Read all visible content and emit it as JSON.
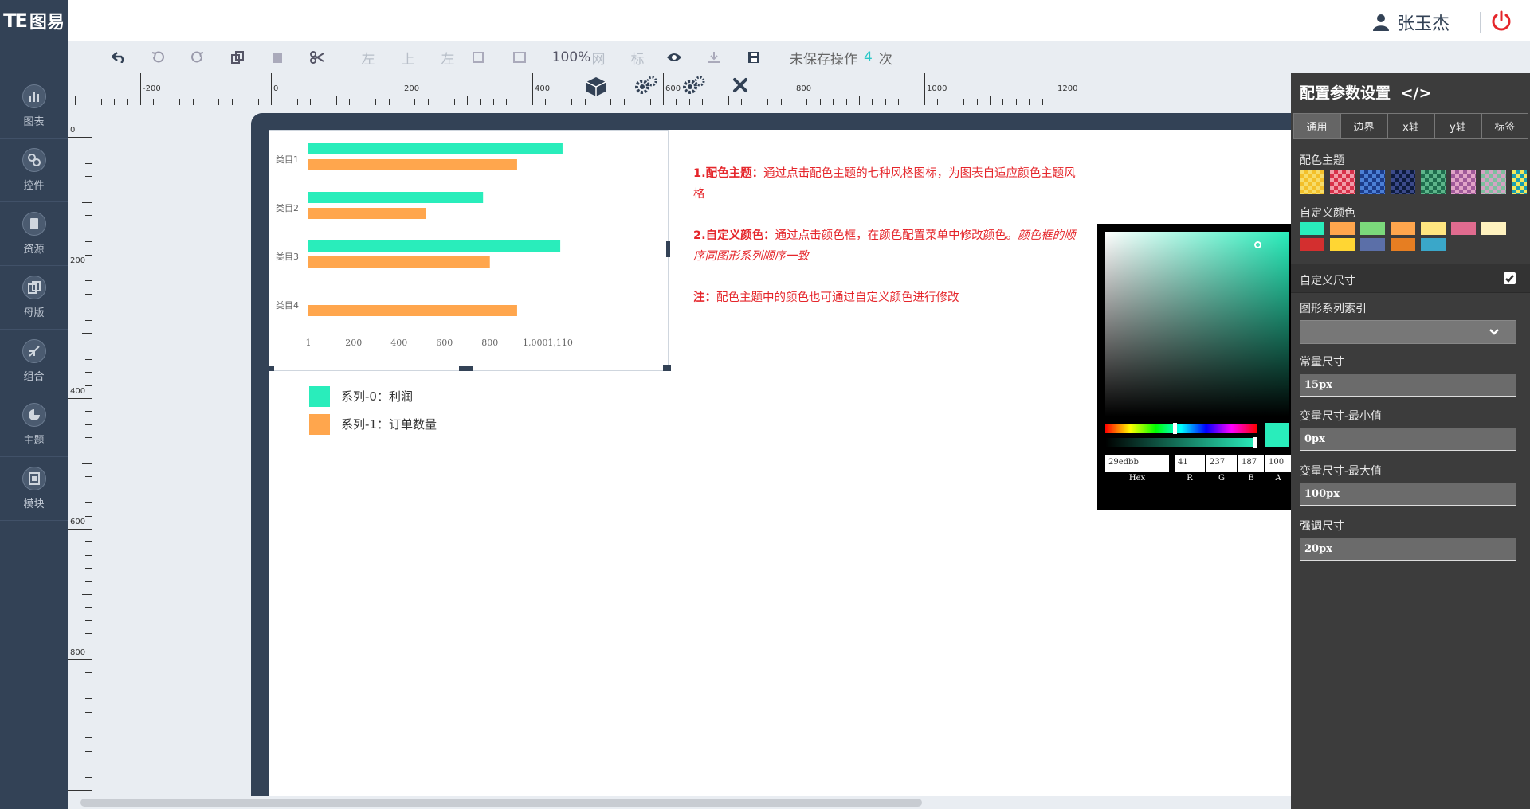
{
  "app": {
    "logo_text": "图易"
  },
  "user": {
    "name": "张玉杰"
  },
  "sidebar": {
    "items": [
      {
        "label": "图表",
        "icon": "chart-icon"
      },
      {
        "label": "控件",
        "icon": "link-icon"
      },
      {
        "label": "资源",
        "icon": "book-icon"
      },
      {
        "label": "母版",
        "icon": "copy-icon"
      },
      {
        "label": "组合",
        "icon": "merge-icon"
      },
      {
        "label": "主题",
        "icon": "pie-icon"
      },
      {
        "label": "模块",
        "icon": "module-icon"
      }
    ]
  },
  "toolbar": {
    "align_left": "左",
    "align_top": "上",
    "align_left2": "左",
    "zoom": "100%",
    "grid": "网",
    "ruler": "标",
    "unsaved_prefix": "未保存操作",
    "unsaved_count": "4",
    "unsaved_suffix": "次"
  },
  "ruler": {
    "h_labels": [
      "-200",
      "0",
      "200",
      "400",
      "600",
      "800",
      "1000",
      "1200"
    ],
    "v_labels": [
      "0",
      "200",
      "400",
      "600",
      "800"
    ]
  },
  "chart_data": {
    "type": "bar",
    "orientation": "horizontal",
    "categories": [
      "类目1",
      "类目2",
      "类目3",
      "类目4"
    ],
    "series": [
      {
        "name": "系列-0：利润",
        "color": "#29edbb",
        "values": [
          1120,
          770,
          1110,
          null
        ]
      },
      {
        "name": "系列-1：订单数量",
        "color": "#ffa64d",
        "values": [
          920,
          520,
          800,
          920
        ]
      }
    ],
    "x_ticks": [
      "1",
      "200",
      "400",
      "600",
      "800",
      "1,000",
      "1,110"
    ],
    "x_tick_values": [
      1,
      200,
      400,
      600,
      800,
      1000,
      1110
    ],
    "xlim": [
      1,
      1250
    ],
    "legend_position": "bottom-left"
  },
  "notes": {
    "n1_title": "1.配色主题：",
    "n1_text": "通过点击配色主题的七种风格图标，为图表自适应颜色主题风格",
    "n2_title": "2.自定义颜色：",
    "n2_text": "通过点击颜色框，在颜色配置菜单中修改颜色。",
    "n2_italic": "颜色框的顺序同图形系列顺序一致",
    "n3_title": "注：",
    "n3_text": "配色主题中的颜色也可通过自定义颜色进行修改"
  },
  "picker": {
    "hex": "29edbb",
    "r": "41",
    "g": "237",
    "b": "187",
    "a": "100",
    "hex_label": "Hex",
    "r_label": "R",
    "g_label": "G",
    "b_label": "B",
    "a_label": "A",
    "color": "#29edbb"
  },
  "panel": {
    "title": "配置参数设置",
    "tabs": [
      "通用",
      "边界",
      "x轴",
      "y轴",
      "标签"
    ],
    "theme_label": "配色主题",
    "custom_color_label": "自定义颜色",
    "custom_colors": [
      "#29edbb",
      "#ffa64d",
      "#7bd97b",
      "#ffa64d",
      "#ffe680",
      "#e06b8f",
      "#fff2bf",
      "#d32f2f",
      "#ffd633",
      "#5b6fa8",
      "#e67e22",
      "#3aa7c9"
    ],
    "custom_size_label": "自定义尺寸",
    "series_index_label": "图形系列索引",
    "const_size_label": "常量尺寸",
    "const_size_value": "15px",
    "var_min_label": "变量尺寸-最小值",
    "var_min_value": "0px",
    "var_max_label": "变量尺寸-最大值",
    "var_max_value": "100px",
    "emphasis_label": "强调尺寸",
    "emphasis_value": "20px"
  }
}
